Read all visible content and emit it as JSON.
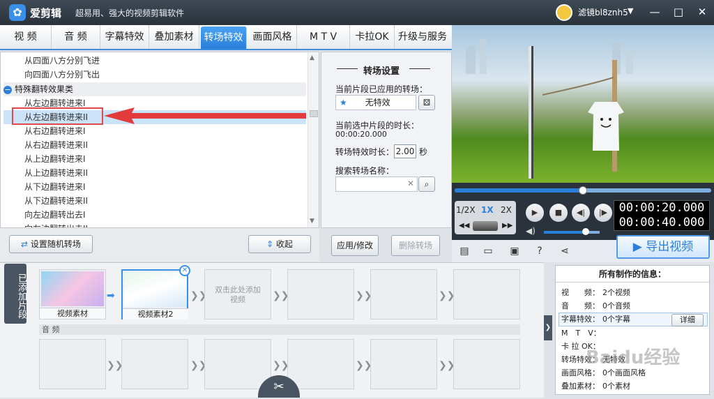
{
  "app": {
    "title": "爱剪辑",
    "subtitle": "超易用、强大的视频剪辑软件",
    "username": "滤镜bl8znh5"
  },
  "tabs": [
    "视 频",
    "音 频",
    "字幕特效",
    "叠加素材",
    "转场特效",
    "画面风格",
    "M T V",
    "卡拉OK",
    "升级与服务"
  ],
  "active_tab": "转场特效",
  "list": {
    "items_top": [
      "从四面八方分别飞进",
      "向四面八方分别飞出"
    ],
    "group": "特殊翻转效果类",
    "items": [
      "从左边翻转进来I",
      "从左边翻转进来II",
      "从右边翻转进来I",
      "从右边翻转进来II",
      "从上边翻转进来I",
      "从上边翻转进来II",
      "从下边翻转进来I",
      "从下边翻转进来II",
      "向左边翻转出去I",
      "向左边翻转出去II"
    ],
    "selected": "从左边翻转进来II"
  },
  "left_buttons": {
    "random": "设置随机转场",
    "collapse": "收起"
  },
  "settings": {
    "title": "转场设置",
    "applied_label": "当前片段已应用的转场：",
    "applied_value": "无特效",
    "duration_label": "当前选中片段的时长：",
    "duration_value": "00:00:20.000",
    "effect_duration_label": "转场特效时长：",
    "effect_duration_value": "2.00",
    "effect_duration_unit": "秒",
    "search_label": "搜索转场名称：",
    "search_value": "",
    "apply_btn": "应用/修改",
    "delete_btn": "删除转场"
  },
  "player": {
    "speeds": [
      "1/2X",
      "1X",
      "2X"
    ],
    "active_speed": "1X",
    "current_time": "00:00:20.000",
    "total_time": "00:00:40.000",
    "progress": 0.5,
    "volume": 0.75
  },
  "export_label": "导出视频",
  "timeline": {
    "side_tab": "已添加片段",
    "clips": [
      {
        "label": "视频素材"
      },
      {
        "label": "视频素材2"
      }
    ],
    "add_prompt": "双击此处添加视频",
    "audio_label": "音 频"
  },
  "info": {
    "title": "所有制作的信息：",
    "rows": [
      {
        "k": "视　　频：",
        "v": "2个视频"
      },
      {
        "k": "音　　频：",
        "v": "0个音频"
      },
      {
        "k": "字幕特效：",
        "v": "0个字幕"
      },
      {
        "k": "M　T　V：",
        "v": ""
      },
      {
        "k": "卡 拉 OK：",
        "v": ""
      },
      {
        "k": "转场特效：",
        "v": "无特效"
      },
      {
        "k": "画面风格：",
        "v": "0个画面风格"
      },
      {
        "k": "叠加素材：",
        "v": "0个素材"
      }
    ],
    "detail_btn": "详细"
  },
  "watermark": "Baidu经验"
}
